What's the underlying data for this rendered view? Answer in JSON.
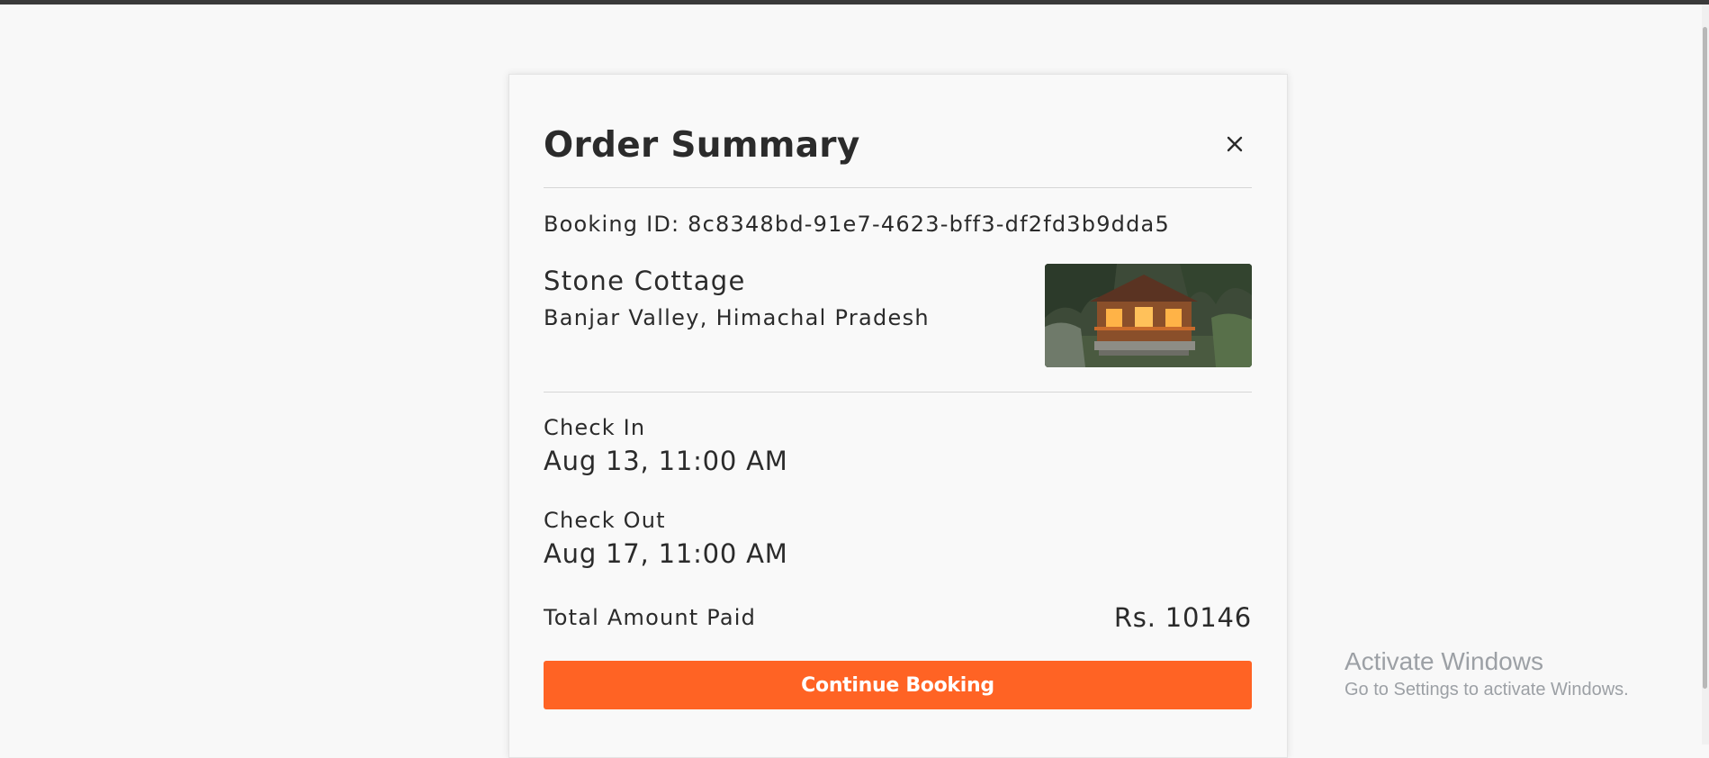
{
  "modal": {
    "title": "Order Summary",
    "close_icon": "close-icon",
    "booking_id": "Booking ID: 8c8348bd-91e7-4623-bff3-df2fd3b9dda5",
    "property": {
      "name": "Stone Cottage",
      "location": "Banjar Valley, Himachal Pradesh"
    },
    "check_in": {
      "label": "Check In",
      "value": "Aug 13, 11:00 AM"
    },
    "check_out": {
      "label": "Check Out",
      "value": "Aug 17, 11:00 AM"
    },
    "total": {
      "label": "Total Amount Paid",
      "value": "Rs. 10146"
    },
    "continue_label": "Continue Booking",
    "accent_color": "#ff6324"
  },
  "watermark": {
    "title": "Activate Windows",
    "subtitle": "Go to Settings to activate Windows."
  }
}
